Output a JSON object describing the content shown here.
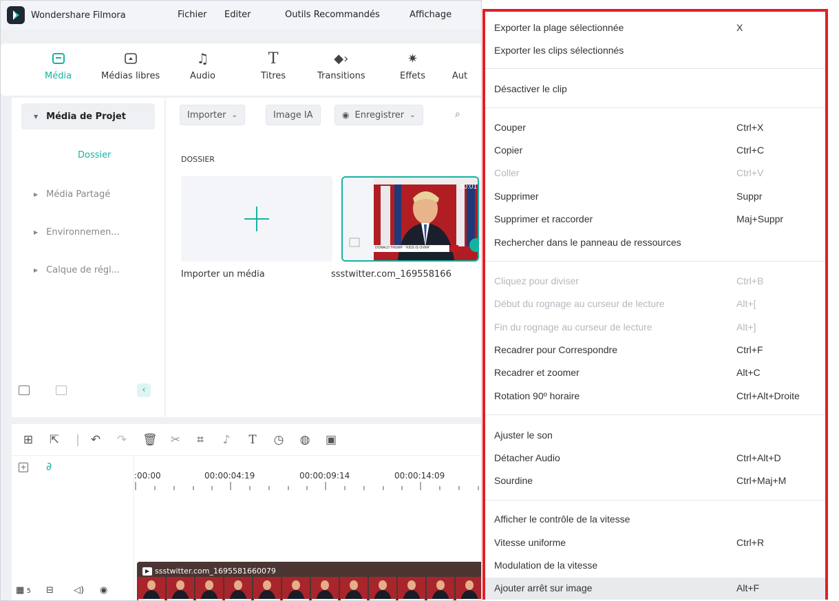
{
  "app": {
    "name": "Wondershare Filmora",
    "menu": [
      "Fichier",
      "Editer",
      "Outils Recommandés",
      "Affichage"
    ],
    "tools": [
      {
        "label": "Média",
        "icon": "media-icon",
        "active": true
      },
      {
        "label": "Médias libres",
        "icon": "cloud-media-icon"
      },
      {
        "label": "Audio",
        "icon": "music-note-icon"
      },
      {
        "label": "Titres",
        "icon": "text-icon"
      },
      {
        "label": "Transitions",
        "icon": "transition-icon"
      },
      {
        "label": "Effets",
        "icon": "effects-icon"
      },
      {
        "label": "Aut",
        "icon": ""
      }
    ],
    "sidebar": {
      "items": [
        "Média de Projet",
        "Média Partagé",
        "Environnemen...",
        "Calque de régl..."
      ],
      "folder": "Dossier"
    },
    "media": {
      "buttons": [
        "Importer",
        "Image IA",
        "Enregistrer"
      ],
      "section_label": "DOSSIER",
      "import_label": "Importer un média",
      "clip_label": "ssstwitter.com_169558166",
      "clip_timecode": "00:01",
      "clip_caption": "DONALD TRUMP · 'KIDS IS OVER'"
    },
    "timeline": {
      "timecodes": [
        ":00:00",
        "00:00:04:19",
        "00:00:09:14",
        "00:00:14:09"
      ],
      "track_clip_label": "ssstwitter.com_1695581660079",
      "track_count": "5"
    }
  },
  "context_menu": {
    "accent": "#e01f26",
    "items": [
      {
        "label": "Exporter la plage sélectionnée",
        "shortcut": "X"
      },
      {
        "label": "Exporter les clips sélectionnés",
        "shortcut": ""
      },
      {
        "label": "Désactiver le clip",
        "shortcut": ""
      },
      {
        "label": "Couper",
        "shortcut": "Ctrl+X"
      },
      {
        "label": "Copier",
        "shortcut": "Ctrl+C"
      },
      {
        "label": "Coller",
        "shortcut": "Ctrl+V",
        "disabled": true
      },
      {
        "label": "Supprimer",
        "shortcut": "Suppr"
      },
      {
        "label": "Supprimer et raccorder",
        "shortcut": "Maj+Suppr"
      },
      {
        "label": "Rechercher dans le panneau de ressources",
        "shortcut": ""
      },
      {
        "label": "Cliquez pour diviser",
        "shortcut": "Ctrl+B",
        "disabled": true
      },
      {
        "label": "Début du rognage au curseur de lecture",
        "shortcut": "Alt+[",
        "disabled": true
      },
      {
        "label": "Fin du rognage au curseur de lecture",
        "shortcut": "Alt+]",
        "disabled": true
      },
      {
        "label": "Recadrer pour Correspondre",
        "shortcut": "Ctrl+F"
      },
      {
        "label": "Recadrer et zoomer",
        "shortcut": "Alt+C"
      },
      {
        "label": "Rotation 90º horaire",
        "shortcut": "Ctrl+Alt+Droite"
      },
      {
        "label": "Ajuster le son",
        "shortcut": ""
      },
      {
        "label": "Détacher Audio",
        "shortcut": "Ctrl+Alt+D"
      },
      {
        "label": "Sourdine",
        "shortcut": "Ctrl+Maj+M"
      },
      {
        "label": "Afficher le contrôle de la vitesse",
        "shortcut": ""
      },
      {
        "label": "Vitesse uniforme",
        "shortcut": "Ctrl+R"
      },
      {
        "label": "Modulation de la vitesse",
        "shortcut": ""
      },
      {
        "label": "Ajouter arrêt sur image",
        "shortcut": "Alt+F",
        "hover": true
      }
    ]
  }
}
